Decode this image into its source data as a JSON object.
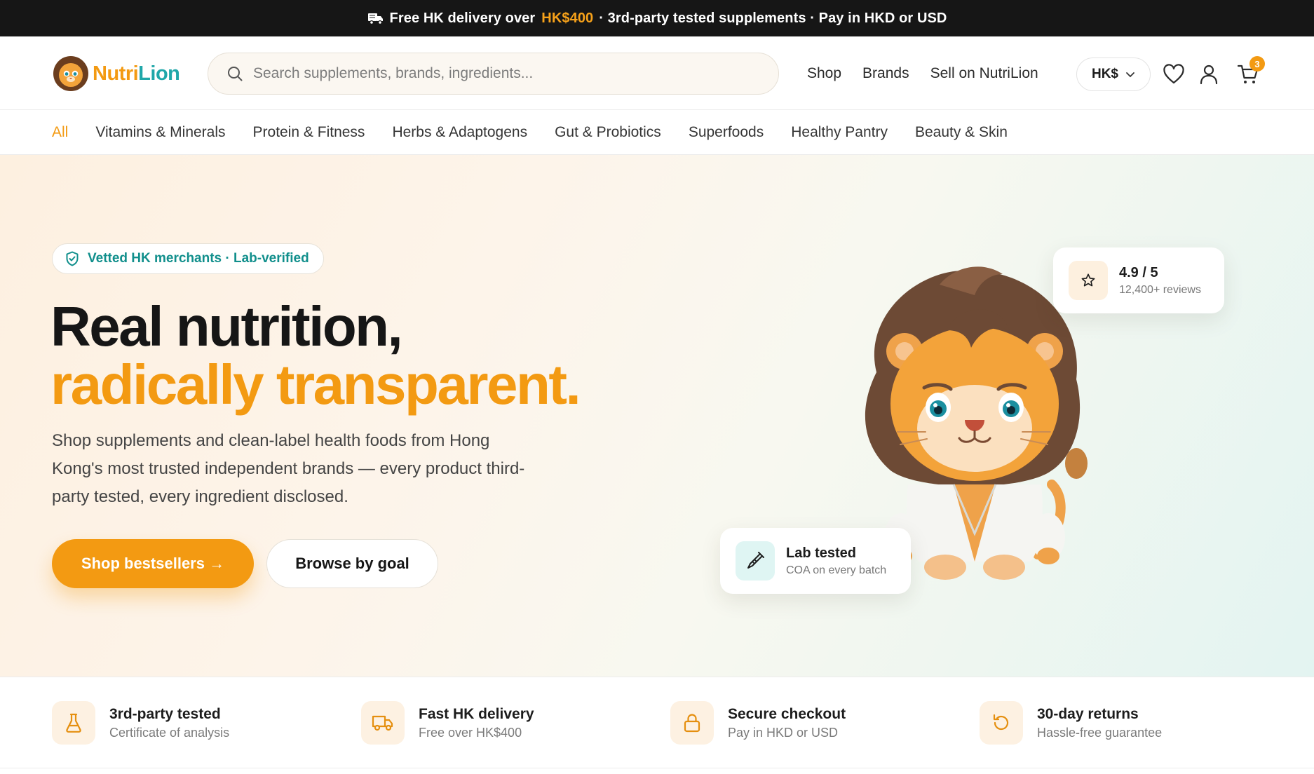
{
  "announcement": {
    "prefix": "Free HK delivery over",
    "highlight": "HK$400",
    "suffix": "· 3rd-party tested supplements · Pay in HKD or USD"
  },
  "header": {
    "logo_part1": "Nutri",
    "logo_part2": "Lion",
    "search_placeholder": "Search supplements, brands, ingredients...",
    "nav": [
      "Shop",
      "Brands",
      "Sell on NutriLion"
    ],
    "currency": "HK$",
    "cart_count": "3"
  },
  "categories": [
    "All",
    "Vitamins & Minerals",
    "Protein & Fitness",
    "Herbs & Adaptogens",
    "Gut & Probiotics",
    "Superfoods",
    "Healthy Pantry",
    "Beauty & Skin"
  ],
  "hero": {
    "badge": "Vetted HK merchants · Lab-verified",
    "headline_line1": "Real nutrition,",
    "headline_line2": "radically transparent.",
    "subtitle": "Shop supplements and clean-label health foods from Hong Kong's most trusted independent brands — every product third-party tested, every ingredient disclosed.",
    "cta_primary": "Shop bestsellers →",
    "cta_secondary": "Browse by goal",
    "rating_card": {
      "title": "4.9 / 5",
      "subtitle": "12,400+ reviews"
    },
    "lab_card": {
      "title": "Lab tested",
      "subtitle": "COA on every batch"
    }
  },
  "features": [
    {
      "icon": "flask-icon",
      "title": "3rd-party tested",
      "subtitle": "Certificate of analysis"
    },
    {
      "icon": "truck-icon",
      "title": "Fast HK delivery",
      "subtitle": "Free over HK$400"
    },
    {
      "icon": "lock-icon",
      "title": "Secure checkout",
      "subtitle": "Pay in HKD or USD"
    },
    {
      "icon": "return-icon",
      "title": "30-day returns",
      "subtitle": "Hassle-free guarantee"
    }
  ],
  "colors": {
    "accent": "#f39a12",
    "teal": "#118f8c",
    "dark": "#161616"
  }
}
